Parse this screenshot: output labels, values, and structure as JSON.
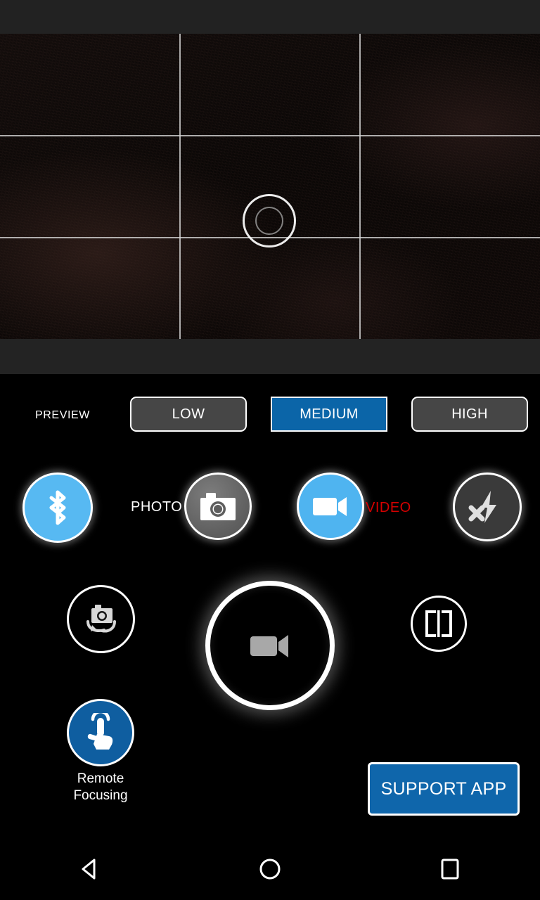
{
  "app": {
    "screen_name": "camera-video-mode"
  },
  "status_bar": {
    "content": ""
  },
  "preview": {
    "grid_overlay": "rule-of-thirds",
    "focus_indicator": "focus-ring",
    "icons": {
      "focus_outer": "focus-ring-outer-icon",
      "focus_inner": "focus-ring-inner-icon"
    }
  },
  "quality": {
    "label": "PREVIEW",
    "options": [
      {
        "label": "LOW",
        "selected": false
      },
      {
        "label": "MEDIUM",
        "selected": true
      },
      {
        "label": "HIGH",
        "selected": false
      }
    ],
    "selected": "MEDIUM",
    "selected_color": "#0b65a8",
    "unselected_color": "#464646"
  },
  "modes": {
    "bluetooth": {
      "icon": "bluetooth-icon",
      "color": "#57b9f2",
      "enabled": true
    },
    "photo": {
      "label": "PHOTO",
      "icon": "photo-camera-icon",
      "color": "#5e5e5e",
      "selected": false,
      "label_color": "#ffffff"
    },
    "video": {
      "label": "VIDEO",
      "icon": "video-camera-icon",
      "color": "#4fb4f0",
      "selected": true,
      "label_color": "#d40000"
    },
    "flash": {
      "icon": "flash-off-icon",
      "color": "#3a3a3a",
      "state": "off"
    }
  },
  "actions": {
    "switch_camera": {
      "icon": "switch-camera-icon"
    },
    "shutter": {
      "icon": "video-camera-icon",
      "mode": "video"
    },
    "mirror": {
      "icon": "mirror-flip-icon"
    },
    "remote_focus": {
      "icon": "touch-tap-icon",
      "label_line1": "Remote",
      "label_line2": "Focusing",
      "color": "#0f5ea0"
    },
    "support": {
      "label": "SUPPORT APP",
      "color": "#0f66ab"
    }
  },
  "navbar": {
    "back": "back-triangle-icon",
    "home": "home-circle-icon",
    "recents": "recents-square-icon"
  }
}
